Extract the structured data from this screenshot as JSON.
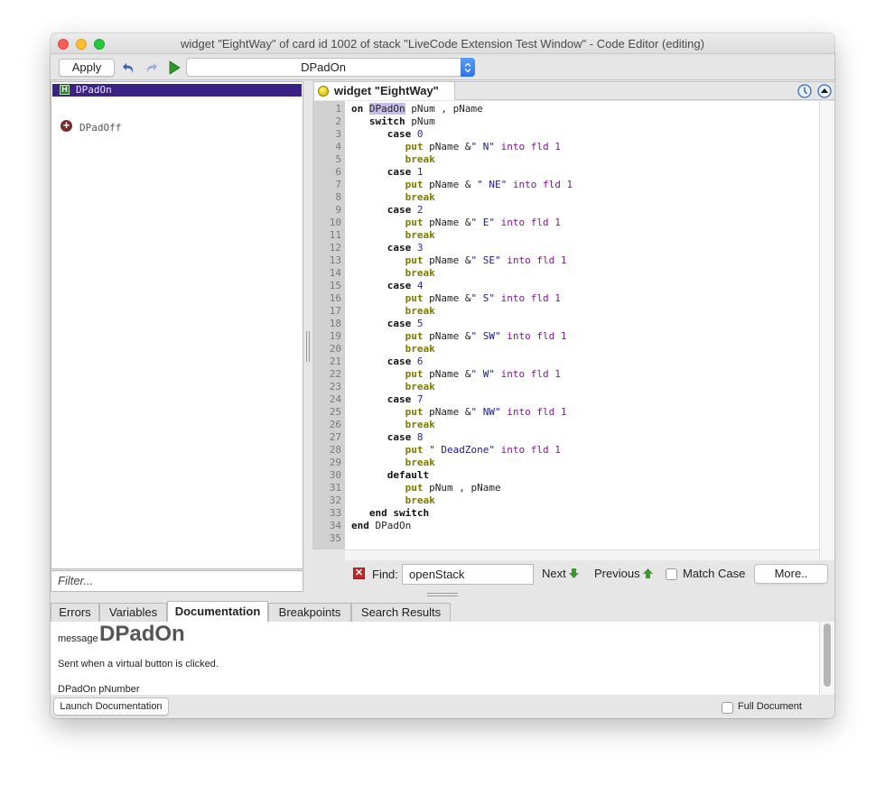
{
  "window": {
    "title": "widget \"EightWay\" of card id 1002 of stack \"LiveCode Extension Test Window\" - Code Editor (editing)"
  },
  "toolbar": {
    "apply_label": "Apply",
    "undo_icon": "undo-arrow",
    "redo_icon": "redo-arrow",
    "run_icon": "play-triangle",
    "handler_select_value": "DPadOn"
  },
  "handlers": {
    "items": [
      {
        "label": "DPadOn",
        "badge": "H",
        "selected": true
      },
      {
        "label": "DPadOff",
        "badge": "+",
        "selected": false
      }
    ],
    "filter_placeholder": "Filter..."
  },
  "editor": {
    "tab_label": "widget \"EightWay\"",
    "tab_icon": "yellow-dot",
    "history_icon": "clock",
    "collapse_icon": "up-triangle-circle",
    "lines": [
      "on DPadOn pNum , pName",
      "   switch pNum",
      "      case 0",
      "         put pName &\" N\" into fld 1",
      "         break",
      "      case 1",
      "         put pName & \" NE\" into fld 1",
      "         break",
      "      case 2",
      "         put pName &\" E\" into fld 1",
      "         break",
      "      case 3",
      "         put pName &\" SE\" into fld 1",
      "         break",
      "      case 4",
      "         put pName &\" S\" into fld 1",
      "         break",
      "      case 5",
      "         put pName &\" SW\" into fld 1",
      "         break",
      "      case 6",
      "         put pName &\" W\" into fld 1",
      "         break",
      "      case 7",
      "         put pName &\" NW\" into fld 1",
      "         break",
      "      case 8",
      "         put \" DeadZone\" into fld 1",
      "         break",
      "      default",
      "         put pNum , pName",
      "         break",
      "   end switch",
      "end DPadOn",
      ""
    ],
    "highlighted_word": "DPadOn"
  },
  "find": {
    "label": "Find:",
    "value": "openStack",
    "next_label": "Next",
    "previous_label": "Previous",
    "match_case_label": "Match Case",
    "match_case_checked": false,
    "more_label": "More.."
  },
  "bottom": {
    "tabs": [
      {
        "label": "Errors",
        "active": false
      },
      {
        "label": "Variables",
        "active": false
      },
      {
        "label": "Documentation",
        "active": true
      },
      {
        "label": "Breakpoints",
        "active": false
      },
      {
        "label": "Search Results",
        "active": false
      }
    ],
    "doc": {
      "kind": "message",
      "name": "DPadOn",
      "description": "Sent when a virtual button is clicked.",
      "syntax": "DPadOn pNumber"
    },
    "launch_label": "Launch Documentation",
    "full_document_label": "Full Document",
    "full_document_checked": false
  },
  "colors": {
    "selection": "#3a2383",
    "keyword_put": "#7a7a00",
    "string": "#1a1a8a",
    "into": "#7a1a8a",
    "highlight": "#c8bde8"
  }
}
